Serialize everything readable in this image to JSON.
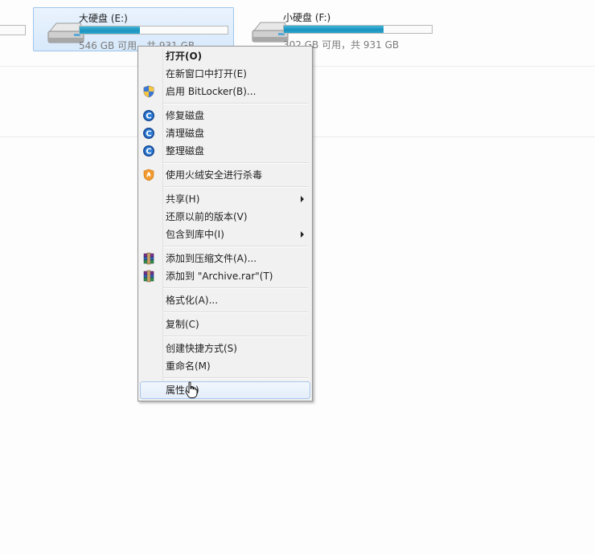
{
  "drives": [
    {
      "name": "大硬盘 (E:)",
      "free": "546 GB 可用，共 931 GB",
      "used_fraction": 0.41,
      "selected": true
    },
    {
      "name": "小硬盘 (F:)",
      "free": "302 GB 可用，共 931 GB",
      "used_fraction": 0.675,
      "selected": false
    }
  ],
  "menu": {
    "items": [
      {
        "label": "打开(O)",
        "bold": true
      },
      {
        "label": "在新窗口中打开(E)"
      },
      {
        "label": "启用 BitLocker(B)...",
        "icon": "shield-icon"
      },
      {
        "label": "修复磁盘",
        "icon": "cleaner-icon"
      },
      {
        "label": "清理磁盘",
        "icon": "cleaner-icon"
      },
      {
        "label": "整理磁盘",
        "icon": "cleaner-icon"
      },
      {
        "label": "使用火绒安全进行杀毒",
        "icon": "huorong-icon"
      },
      {
        "label": "共享(H)",
        "submenu": true
      },
      {
        "label": "还原以前的版本(V)"
      },
      {
        "label": "包含到库中(I)",
        "submenu": true
      },
      {
        "label": "添加到压缩文件(A)...",
        "icon": "winrar-icon"
      },
      {
        "label": "添加到 \"Archive.rar\"(T)",
        "icon": "winrar-icon"
      },
      {
        "label": "格式化(A)..."
      },
      {
        "label": "复制(C)"
      },
      {
        "label": "创建快捷方式(S)"
      },
      {
        "label": "重命名(M)"
      },
      {
        "label": "属性(R)",
        "hover": true
      }
    ]
  },
  "colors": {
    "selection_fill": "#d7e9fb",
    "selection_border": "#9ec5ea",
    "bar_fill": "#1c92c0",
    "menu_bg": "#f1f1f1",
    "hover_border": "#a8c7ea"
  }
}
